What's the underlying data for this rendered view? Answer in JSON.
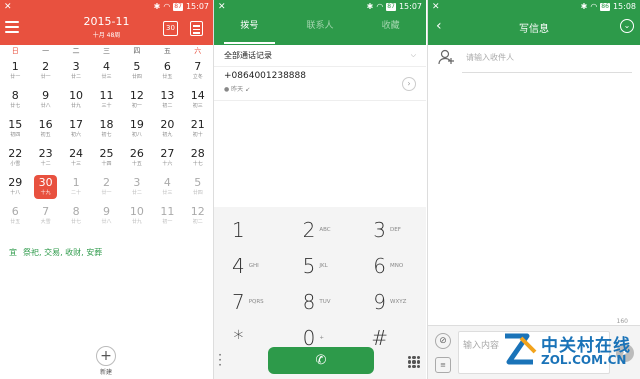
{
  "status_left": {
    "icon": "x-icon",
    "time": "15:07",
    "battery": "87"
  },
  "status_mid": {
    "time": "15:07",
    "battery": "87"
  },
  "status_right": {
    "time": "15:08",
    "battery": "86"
  },
  "calendar": {
    "title": "2015-11",
    "subtitle": "十月 48周",
    "today_icon_label": "30",
    "weekdays": [
      "日",
      "一",
      "二",
      "三",
      "四",
      "五",
      "六"
    ],
    "days": [
      {
        "n": "1",
        "s": "廿一"
      },
      {
        "n": "2",
        "s": "廿一"
      },
      {
        "n": "3",
        "s": "廿二"
      },
      {
        "n": "4",
        "s": "廿三"
      },
      {
        "n": "5",
        "s": "廿四"
      },
      {
        "n": "6",
        "s": "廿五"
      },
      {
        "n": "7",
        "s": "立冬"
      },
      {
        "n": "8",
        "s": "廿七"
      },
      {
        "n": "9",
        "s": "廿八"
      },
      {
        "n": "10",
        "s": "廿九"
      },
      {
        "n": "11",
        "s": "三十"
      },
      {
        "n": "12",
        "s": "初一"
      },
      {
        "n": "13",
        "s": "初二"
      },
      {
        "n": "14",
        "s": "初三"
      },
      {
        "n": "15",
        "s": "初四"
      },
      {
        "n": "16",
        "s": "初五"
      },
      {
        "n": "17",
        "s": "初六"
      },
      {
        "n": "18",
        "s": "初七"
      },
      {
        "n": "19",
        "s": "初八"
      },
      {
        "n": "20",
        "s": "初九"
      },
      {
        "n": "21",
        "s": "初十"
      },
      {
        "n": "22",
        "s": "小雪"
      },
      {
        "n": "23",
        "s": "十二"
      },
      {
        "n": "24",
        "s": "十三"
      },
      {
        "n": "25",
        "s": "十四"
      },
      {
        "n": "26",
        "s": "十五"
      },
      {
        "n": "27",
        "s": "十六"
      },
      {
        "n": "28",
        "s": "十七"
      },
      {
        "n": "29",
        "s": "十八"
      },
      {
        "n": "30",
        "s": "十九"
      },
      {
        "n": "1",
        "s": "二十"
      },
      {
        "n": "2",
        "s": "廿一"
      },
      {
        "n": "3",
        "s": "廿二"
      },
      {
        "n": "4",
        "s": "廿三"
      },
      {
        "n": "5",
        "s": "廿四"
      },
      {
        "n": "6",
        "s": "廿五"
      },
      {
        "n": "7",
        "s": "大雪"
      },
      {
        "n": "8",
        "s": "廿七"
      },
      {
        "n": "9",
        "s": "廿八"
      },
      {
        "n": "10",
        "s": "廿九"
      },
      {
        "n": "11",
        "s": "初一"
      },
      {
        "n": "12",
        "s": "初二"
      }
    ],
    "yi_label": "宜",
    "yi_text": "祭祀, 交易, 收财, 安葬",
    "new_label": "新建"
  },
  "dialer": {
    "tabs": [
      "拨号",
      "联系人",
      "收藏"
    ],
    "log_header": "全部通话记录",
    "entry": {
      "number": "+0864001238888",
      "when": "昨天"
    },
    "keys": [
      {
        "d": "1",
        "l": ""
      },
      {
        "d": "2",
        "l": "ABC"
      },
      {
        "d": "3",
        "l": "DEF"
      },
      {
        "d": "4",
        "l": "GHI"
      },
      {
        "d": "5",
        "l": "JKL"
      },
      {
        "d": "6",
        "l": "MNO"
      },
      {
        "d": "7",
        "l": "PQRS"
      },
      {
        "d": "8",
        "l": "TUV"
      },
      {
        "d": "9",
        "l": "WXYZ"
      },
      {
        "d": "*",
        "l": ""
      },
      {
        "d": "0",
        "l": "+"
      },
      {
        "d": "#",
        "l": ""
      }
    ]
  },
  "message": {
    "title": "写信息",
    "recipient_placeholder": "请输入收件人",
    "counter": "160",
    "input_placeholder": "输入内容"
  },
  "watermark": {
    "line1": "中关村在线",
    "line2": "ZOL.COM.CN"
  },
  "colors": {
    "calendar_accent": "#e8513f",
    "green_accent": "#2d9a4a"
  }
}
